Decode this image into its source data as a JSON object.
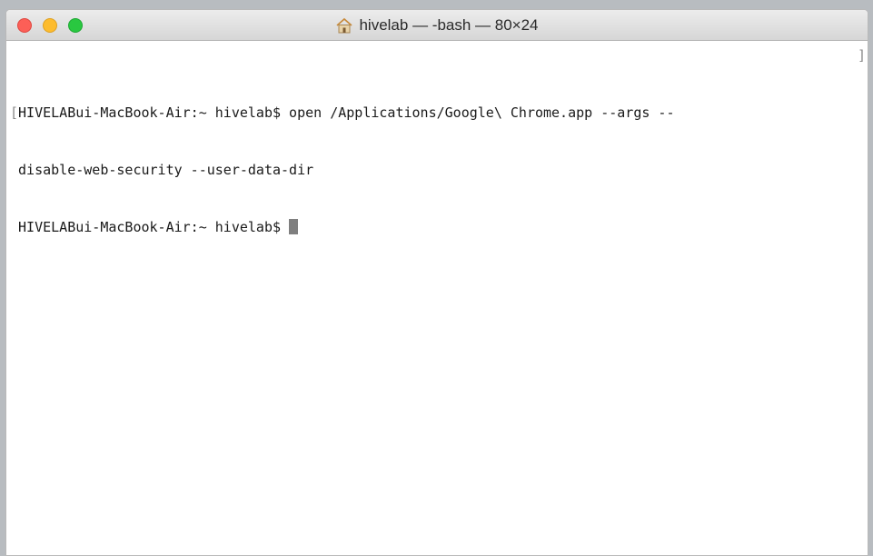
{
  "window": {
    "title": "hivelab — -bash — 80×24",
    "title_icon": "home-icon",
    "controls": [
      "close",
      "minimize",
      "zoom"
    ]
  },
  "terminal": {
    "lines": [
      "HIVELABui-MacBook-Air:~ hivelab$ open /Applications/Google\\ Chrome.app --args --",
      " disable-web-security --user-data-dir",
      " HIVELABui-MacBook-Air:~ hivelab$ "
    ],
    "left_bracket": "[",
    "right_bracket": "]"
  },
  "colors": {
    "close": "#fc5f57",
    "minimize": "#fdbc2e",
    "zoom": "#29c840",
    "cursor": "#7f7f7f"
  }
}
